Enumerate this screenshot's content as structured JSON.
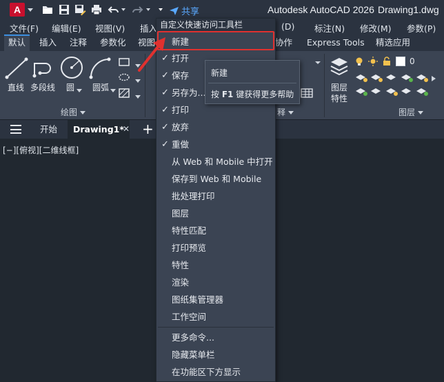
{
  "titlebar": {
    "app_logo_letter": "A",
    "share_label": "共享",
    "app_title": "Autodesk AutoCAD 2026",
    "document_title": "Drawing1.dwg"
  },
  "menubar": {
    "items": [
      "文件(F)",
      "编辑(E)",
      "视图(V)",
      "插入",
      "(D)",
      "标注(N)",
      "修改(M)",
      "参数(P)"
    ]
  },
  "ribbon_tabs": {
    "items": [
      "默认",
      "插入",
      "注释",
      "参数化",
      "视图",
      "协作",
      "Express Tools",
      "精选应用"
    ],
    "active": "默认"
  },
  "ribbon": {
    "draw_tools": {
      "line": "直线",
      "polyline": "多段线",
      "circle": "圆",
      "arc": "圆弧"
    },
    "draw_panel": "绘图",
    "annotation_panel_fragment": "释",
    "layer_properties": [
      "图层",
      "特性"
    ],
    "layers_panel": "图层",
    "layer_value": "0"
  },
  "doc_tabs": {
    "start": "开始",
    "drawing": "Drawing1*"
  },
  "canvas": {
    "viewport_label": "[−][俯视][二维线框]"
  },
  "dropdown": {
    "header": "自定义快速访问工具栏",
    "items": [
      {
        "label": "新建",
        "checked": false
      },
      {
        "label": "打开",
        "checked": true
      },
      {
        "label": "保存",
        "checked": true
      },
      {
        "label": "另存为...",
        "checked": true
      },
      {
        "label": "打印",
        "checked": true
      },
      {
        "label": "放弃",
        "checked": true
      },
      {
        "label": "重做",
        "checked": true
      },
      {
        "label": "从 Web 和 Mobile 中打开",
        "checked": false
      },
      {
        "label": "保存到 Web 和 Mobile",
        "checked": false
      },
      {
        "label": "批处理打印",
        "checked": false
      },
      {
        "label": "图层",
        "checked": false
      },
      {
        "label": "特性匹配",
        "checked": false
      },
      {
        "label": "打印预览",
        "checked": false
      },
      {
        "label": "特性",
        "checked": false
      },
      {
        "label": "渲染",
        "checked": false
      },
      {
        "label": "图纸集管理器",
        "checked": false
      },
      {
        "label": "工作空间",
        "checked": false
      },
      {
        "label": "更多命令...",
        "checked": false
      },
      {
        "label": "隐藏菜单栏",
        "checked": false
      },
      {
        "label": "在功能区下方显示",
        "checked": false
      }
    ],
    "check_glyph": "✓"
  },
  "tooltip": {
    "title": "新建",
    "help_prefix": "按",
    "help_key": "F1",
    "help_suffix": "键获得更多帮助"
  },
  "colors": {
    "brand_red": "#c8102e",
    "accent_blue": "#3c8fe0",
    "highlight_red": "#e0312f",
    "share_blue": "#5aa9ff"
  }
}
